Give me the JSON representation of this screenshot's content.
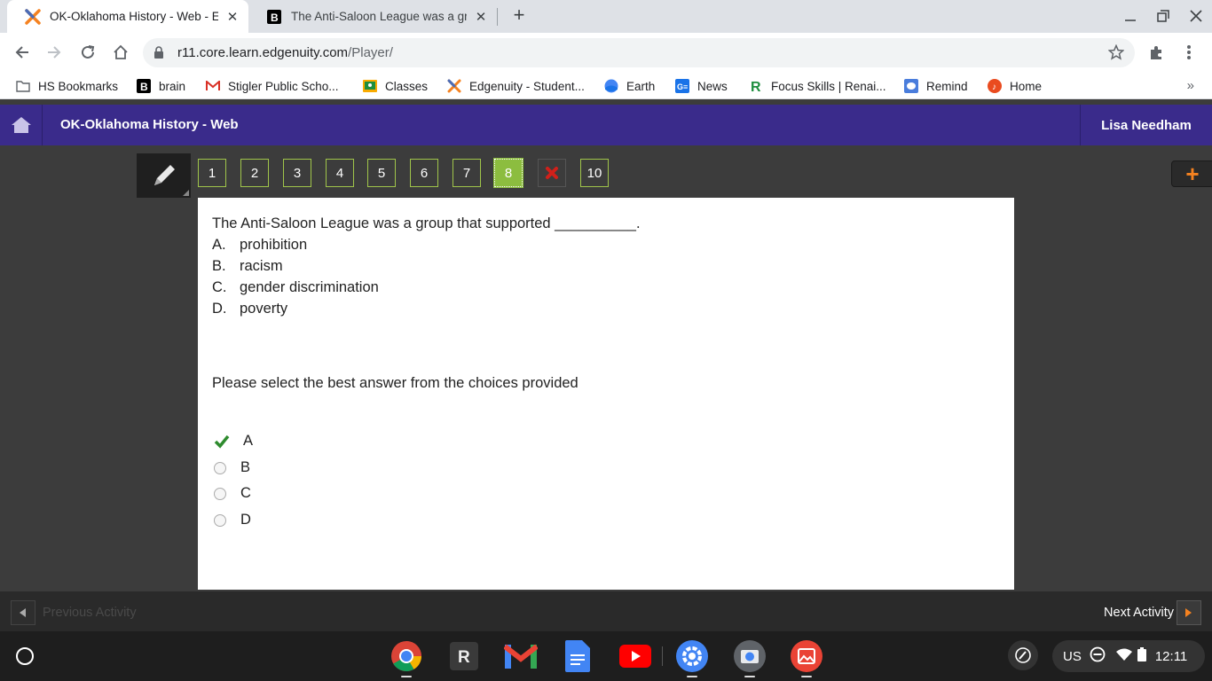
{
  "browser": {
    "tabs": [
      {
        "title": "OK-Oklahoma History - Web - Edgenuity",
        "active": true
      },
      {
        "title": "The Anti-Saloon League was a gr",
        "active": false
      }
    ],
    "url_host": "r11.core.learn.edgenuity.com",
    "url_path": "/Player/",
    "bookmarks": [
      "HS Bookmarks",
      "brain",
      "Stigler Public Scho...",
      "Classes",
      "Edgenuity - Student...",
      "Earth",
      "News",
      "Focus Skills | Renai...",
      "Remind",
      "Home"
    ],
    "bookmarks_more": "»"
  },
  "app": {
    "course_title": "OK-Oklahoma History - Web",
    "user_name": "Lisa Needham",
    "accent_color": "#3a2b8b"
  },
  "question_nav": {
    "items": [
      "1",
      "2",
      "3",
      "4",
      "5",
      "6",
      "7",
      "8",
      "",
      "10"
    ],
    "current": "8",
    "wrong_index": 8,
    "plus_label": "+"
  },
  "question": {
    "text": "The Anti-Saloon League was a group that supported __________.",
    "choices": [
      {
        "letter": "A.",
        "text": "prohibition"
      },
      {
        "letter": "B.",
        "text": "racism"
      },
      {
        "letter": "C.",
        "text": "gender discrimination"
      },
      {
        "letter": "D.",
        "text": "poverty"
      }
    ],
    "instructions": "Please select the best answer from the choices provided",
    "answers": [
      {
        "label": "A",
        "selected": true
      },
      {
        "label": "B",
        "selected": false
      },
      {
        "label": "C",
        "selected": false
      },
      {
        "label": "D",
        "selected": false
      }
    ]
  },
  "activity_bar": {
    "previous_label": "Previous Activity",
    "next_label": "Next Activity"
  },
  "shelf": {
    "apps": [
      "chrome",
      "r-app",
      "gmail",
      "docs",
      "youtube",
      "settings",
      "camera",
      "gallery"
    ],
    "locale": "US",
    "time": "12:11"
  }
}
